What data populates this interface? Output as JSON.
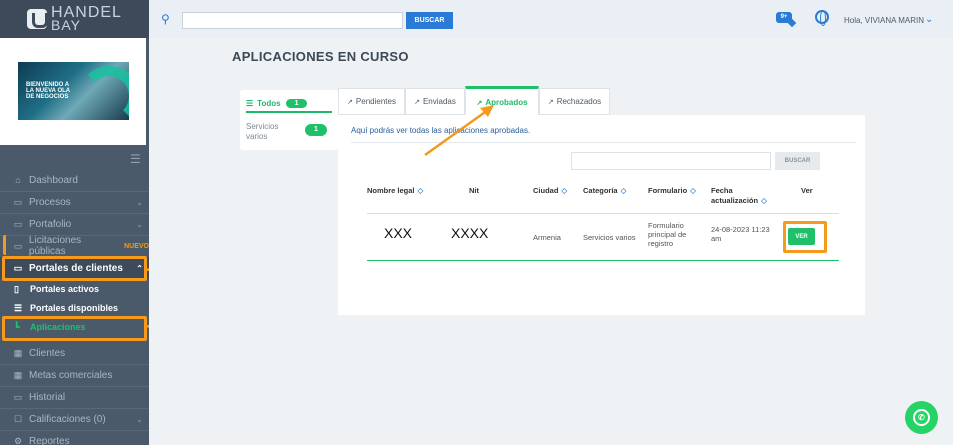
{
  "brand": {
    "logo_top": "HANDEL",
    "logo_bottom": "BAY"
  },
  "banner": {
    "text": "BIENVENIDO A LA NUEVA OLA DE NEGOCIOS"
  },
  "topbar": {
    "search_placeholder": "",
    "search_button": "BUSCAR",
    "notification_badge": "9+",
    "greeting": "Hola, VIVIANA MARIN"
  },
  "sidebar": {
    "items": [
      {
        "label": "Dashboard",
        "icon": "home-icon"
      },
      {
        "label": "Procesos",
        "icon": "briefcase-icon",
        "has_chevron": true
      },
      {
        "label": "Portafolio",
        "icon": "briefcase-icon",
        "has_chevron": true
      },
      {
        "label": "Licitaciones públicas",
        "icon": "briefcase-icon",
        "badge": "NUEVO"
      },
      {
        "label": "Portales de clientes",
        "icon": "briefcase-icon",
        "has_chevron": true,
        "active": true
      },
      {
        "label": "Clientes",
        "icon": "building-icon"
      },
      {
        "label": "Metas comerciales",
        "icon": "calendar-icon"
      },
      {
        "label": "Historial",
        "icon": "folder-icon"
      },
      {
        "label": "Calificaciones (0)",
        "icon": "checkbox-icon",
        "has_chevron": true
      },
      {
        "label": "Reportes",
        "icon": "gear-icon"
      }
    ],
    "subitems": [
      {
        "label": "Portales activos",
        "icon": "document-icon"
      },
      {
        "label": "Portales disponibles",
        "icon": "list-icon"
      },
      {
        "label": "Aplicaciones",
        "icon": "tree-icon",
        "active": true
      }
    ]
  },
  "main": {
    "title": "APLICACIONES EN CURSO",
    "filters": {
      "todos_label": "Todos",
      "todos_count": "1",
      "category_label": "Servicios varios",
      "category_count": "1"
    },
    "tabs": [
      {
        "label": "Pendientes"
      },
      {
        "label": "Enviadas"
      },
      {
        "label": "Aprobados",
        "active": true
      },
      {
        "label": "Rechazados"
      }
    ],
    "panel": {
      "description": "Aquí podrás ver todas las aplicaciones aprobadas.",
      "search_button": "BUSCAR"
    },
    "table": {
      "columns": [
        "Nombre legal",
        "Nit",
        "Ciudad",
        "Categoría",
        "Formulario",
        "Fecha actualización",
        "Ver"
      ],
      "rows": [
        {
          "nombre_legal": "XXX",
          "nit": "XXXX",
          "ciudad": "Armenia",
          "categoria": "Servicios varios",
          "formulario": "Formulario principal de registro",
          "fecha": "24-08-2023 11:23 am",
          "ver_label": "VER"
        }
      ]
    }
  },
  "colors": {
    "accent_green": "#1fc06a",
    "accent_blue": "#2b7bd6",
    "highlight_orange": "#f59a1b",
    "sidebar_bg": "#4a5a6b"
  }
}
